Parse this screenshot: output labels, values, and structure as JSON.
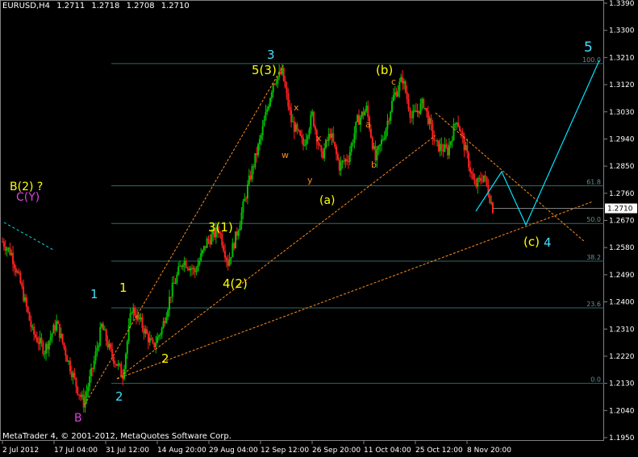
{
  "header": {
    "symbol": "EURUSD,H4",
    "open": "1.2711",
    "high": "1.2718",
    "low": "1.2708",
    "close": "1.2710"
  },
  "footer": {
    "copyright": "MetaTrader 4, © 2001-2012, MetaQuotes Software Corp."
  },
  "colors": {
    "background": "#000000",
    "grid_frame": "#808080",
    "bull": "#00c000",
    "bear": "#ff2020",
    "fib": "#2f6a6a",
    "trend": "#ff8c1a",
    "projection": "#00e5ff",
    "wave_cyan": "#40e0ff",
    "wave_yellow": "#ffff00",
    "wave_magenta": "#e040e0"
  },
  "chart_data": {
    "type": "candlestick",
    "y_axis_labels": [
      "1.3390",
      "1.3300",
      "1.3210",
      "1.3120",
      "1.3030",
      "1.2940",
      "1.2850",
      "1.2760",
      "1.2670",
      "1.2580",
      "1.2490",
      "1.2400",
      "1.2310",
      "1.2220",
      "1.2130",
      "1.2040",
      "1.1950"
    ],
    "x_axis_labels": [
      "2 Jul 2012",
      "17 Jul 04:00",
      "31 Jul 12:00",
      "14 Aug 20:00",
      "29 Aug 04:00",
      "12 Sep 12:00",
      "26 Sep 20:00",
      "11 Oct 04:00",
      "25 Oct 12:00",
      "8 Nov 20:00"
    ],
    "current_price": "1.2710",
    "ylim": [
      1.195,
      1.339
    ],
    "fib_levels": [
      {
        "label": "100.0",
        "price": 1.319
      },
      {
        "label": "61.8",
        "price": 1.2785
      },
      {
        "label": "50.0",
        "price": 1.266
      },
      {
        "label": "38.2",
        "price": 1.2535
      },
      {
        "label": "23.6",
        "price": 1.238
      },
      {
        "label": "0.0",
        "price": 1.213
      }
    ],
    "price_path": [
      {
        "t": 0,
        "p": 1.26
      },
      {
        "t": 3,
        "p": 1.256
      },
      {
        "t": 6,
        "p": 1.246
      },
      {
        "t": 10,
        "p": 1.23
      },
      {
        "t": 14,
        "p": 1.224
      },
      {
        "t": 18,
        "p": 1.233
      },
      {
        "t": 22,
        "p": 1.22
      },
      {
        "t": 25,
        "p": 1.211
      },
      {
        "t": 27,
        "p": 1.2065
      },
      {
        "t": 30,
        "p": 1.218
      },
      {
        "t": 33,
        "p": 1.232
      },
      {
        "t": 36,
        "p": 1.223
      },
      {
        "t": 40,
        "p": 1.216
      },
      {
        "t": 43,
        "p": 1.238
      },
      {
        "t": 46,
        "p": 1.233
      },
      {
        "t": 50,
        "p": 1.225
      },
      {
        "t": 53,
        "p": 1.231
      },
      {
        "t": 56,
        "p": 1.243
      },
      {
        "t": 60,
        "p": 1.254
      },
      {
        "t": 64,
        "p": 1.25
      },
      {
        "t": 68,
        "p": 1.26
      },
      {
        "t": 72,
        "p": 1.264
      },
      {
        "t": 75,
        "p": 1.253
      },
      {
        "t": 78,
        "p": 1.263
      },
      {
        "t": 82,
        "p": 1.28
      },
      {
        "t": 86,
        "p": 1.295
      },
      {
        "t": 90,
        "p": 1.313
      },
      {
        "t": 93,
        "p": 1.316
      },
      {
        "t": 96,
        "p": 1.3
      },
      {
        "t": 100,
        "p": 1.292
      },
      {
        "t": 103,
        "p": 1.302
      },
      {
        "t": 106,
        "p": 1.288
      },
      {
        "t": 109,
        "p": 1.296
      },
      {
        "t": 112,
        "p": 1.285
      },
      {
        "t": 115,
        "p": 1.288
      },
      {
        "t": 118,
        "p": 1.3
      },
      {
        "t": 121,
        "p": 1.304
      },
      {
        "t": 124,
        "p": 1.287
      },
      {
        "t": 127,
        "p": 1.296
      },
      {
        "t": 130,
        "p": 1.308
      },
      {
        "t": 133,
        "p": 1.314
      },
      {
        "t": 136,
        "p": 1.301
      },
      {
        "t": 140,
        "p": 1.306
      },
      {
        "t": 144,
        "p": 1.292
      },
      {
        "t": 148,
        "p": 1.29
      },
      {
        "t": 151,
        "p": 1.301
      },
      {
        "t": 154,
        "p": 1.29
      },
      {
        "t": 157,
        "p": 1.278
      },
      {
        "t": 160,
        "p": 1.282
      },
      {
        "t": 163,
        "p": 1.271
      }
    ],
    "projection_path": [
      {
        "price": 1.271,
        "date": "9 Nov"
      },
      {
        "price": 1.284,
        "date": "14 Nov"
      },
      {
        "price": 1.2655,
        "date": "20 Nov"
      },
      {
        "price": 1.325,
        "date": "5 Dec"
      }
    ],
    "wave_labels": [
      {
        "text": "B(2) ?",
        "color": "wave_yellow"
      },
      {
        "text": "C(Y)",
        "color": "wave_magenta"
      },
      {
        "text": "B",
        "color": "wave_magenta"
      },
      {
        "text": "1",
        "color": "wave_cyan"
      },
      {
        "text": "1",
        "color": "wave_yellow"
      },
      {
        "text": "2",
        "color": "wave_yellow"
      },
      {
        "text": "2",
        "color": "wave_cyan"
      },
      {
        "text": "3(1)",
        "color": "wave_yellow"
      },
      {
        "text": "4(2)",
        "color": "wave_yellow"
      },
      {
        "text": "3",
        "color": "wave_cyan"
      },
      {
        "text": "5(3)",
        "color": "wave_yellow"
      },
      {
        "text": "x",
        "color": "trend"
      },
      {
        "text": "w",
        "color": "trend"
      },
      {
        "text": "x",
        "color": "trend"
      },
      {
        "text": "y",
        "color": "trend"
      },
      {
        "text": "(a)",
        "color": "wave_yellow"
      },
      {
        "text": "a",
        "color": "trend"
      },
      {
        "text": "b",
        "color": "trend"
      },
      {
        "text": "(b)",
        "color": "wave_yellow"
      },
      {
        "text": "c",
        "color": "trend"
      },
      {
        "text": "(c)",
        "color": "wave_yellow"
      },
      {
        "text": "4",
        "color": "wave_cyan"
      },
      {
        "text": "5",
        "color": "wave_cyan"
      }
    ]
  }
}
